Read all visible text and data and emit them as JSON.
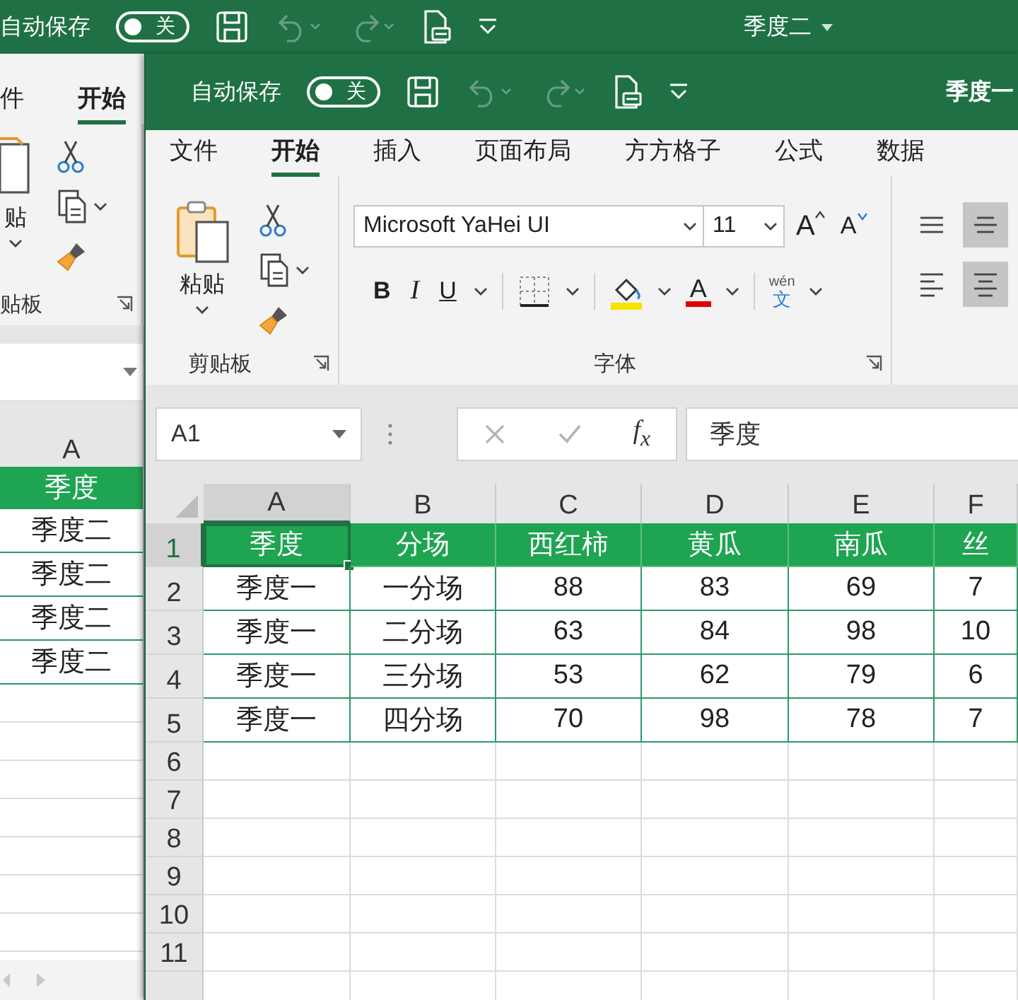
{
  "back_window": {
    "autosave": {
      "label": "自动保存",
      "toggle": "关",
      "on": false
    },
    "quick_access": [
      {
        "kind": "save",
        "disabled": false
      },
      {
        "kind": "undo",
        "disabled": true
      },
      {
        "kind": "redo",
        "disabled": true
      },
      {
        "kind": "touch",
        "disabled": false
      },
      {
        "kind": "customize",
        "disabled": false
      }
    ],
    "title": "季度二",
    "tabs": [
      {
        "label": "件",
        "selected": false
      },
      {
        "label": "开始",
        "selected": true
      }
    ],
    "clipboard": {
      "paste_label": "贴",
      "group_label": "贴板"
    },
    "column": "A",
    "cells": [
      {
        "text": "季度",
        "kind": "header"
      },
      {
        "text": "季度二",
        "kind": "data"
      },
      {
        "text": "季度二",
        "kind": "data"
      },
      {
        "text": "季度二",
        "kind": "data"
      },
      {
        "text": "季度二",
        "kind": "data"
      }
    ]
  },
  "front_window": {
    "autosave": {
      "label": "自动保存",
      "toggle": "关",
      "on": false
    },
    "quick_access": [
      {
        "kind": "save",
        "disabled": false
      },
      {
        "kind": "undo",
        "disabled": true
      },
      {
        "kind": "redo",
        "disabled": true
      },
      {
        "kind": "touch",
        "disabled": false
      },
      {
        "kind": "customize",
        "disabled": false
      }
    ],
    "title": "季度一",
    "tabs": [
      {
        "label": "文件",
        "selected": false
      },
      {
        "label": "开始",
        "selected": true
      },
      {
        "label": "插入",
        "selected": false
      },
      {
        "label": "页面布局",
        "selected": false
      },
      {
        "label": "方方格子",
        "selected": false
      },
      {
        "label": "公式",
        "selected": false
      },
      {
        "label": "数据",
        "selected": false
      }
    ],
    "clipboard": {
      "paste_label": "粘贴",
      "group_label": "剪贴板"
    },
    "font": {
      "name": "Microsoft YaHei UI",
      "size": "11",
      "grow": "A",
      "shrink": "A",
      "bold": "B",
      "italic": "I",
      "underline": "U",
      "font_color": "A",
      "phonetic_top": "wén",
      "phonetic": "文",
      "group_label": "字体"
    },
    "alignment": [
      {
        "kind": "top",
        "selected": false
      },
      {
        "kind": "middle",
        "selected": true
      },
      {
        "kind": "left",
        "selected": false
      },
      {
        "kind": "center",
        "selected": true
      }
    ],
    "formula_bar": {
      "name_box": "A1",
      "function": "f$_{x}$",
      "formula": "季度"
    },
    "grid": {
      "columns": [
        {
          "label": "A",
          "selected": true
        },
        {
          "label": "B",
          "selected": false
        },
        {
          "label": "C",
          "selected": false
        },
        {
          "label": "D",
          "selected": false
        },
        {
          "label": "E",
          "selected": false
        },
        {
          "label": "F",
          "selected": false
        }
      ],
      "rows": [
        {
          "number": "1",
          "selected": true,
          "kind": "header",
          "cells": [
            "季度",
            "分场",
            "西红柿",
            "黄瓜",
            "南瓜",
            "丝"
          ]
        },
        {
          "number": "2",
          "selected": false,
          "kind": "data",
          "cells": [
            "季度一",
            "一分场",
            "88",
            "83",
            "69",
            "7"
          ]
        },
        {
          "number": "3",
          "selected": false,
          "kind": "data",
          "cells": [
            "季度一",
            "二分场",
            "63",
            "84",
            "98",
            "10"
          ]
        },
        {
          "number": "4",
          "selected": false,
          "kind": "data",
          "cells": [
            "季度一",
            "三分场",
            "53",
            "62",
            "79",
            "6"
          ]
        },
        {
          "number": "5",
          "selected": false,
          "kind": "data",
          "cells": [
            "季度一",
            "四分场",
            "70",
            "98",
            "78",
            "7"
          ]
        },
        {
          "number": "6",
          "selected": false
        },
        {
          "number": "7",
          "selected": false
        },
        {
          "number": "8",
          "selected": false
        },
        {
          "number": "9",
          "selected": false
        },
        {
          "number": "10",
          "selected": false
        },
        {
          "number": "11",
          "selected": false
        }
      ]
    }
  }
}
